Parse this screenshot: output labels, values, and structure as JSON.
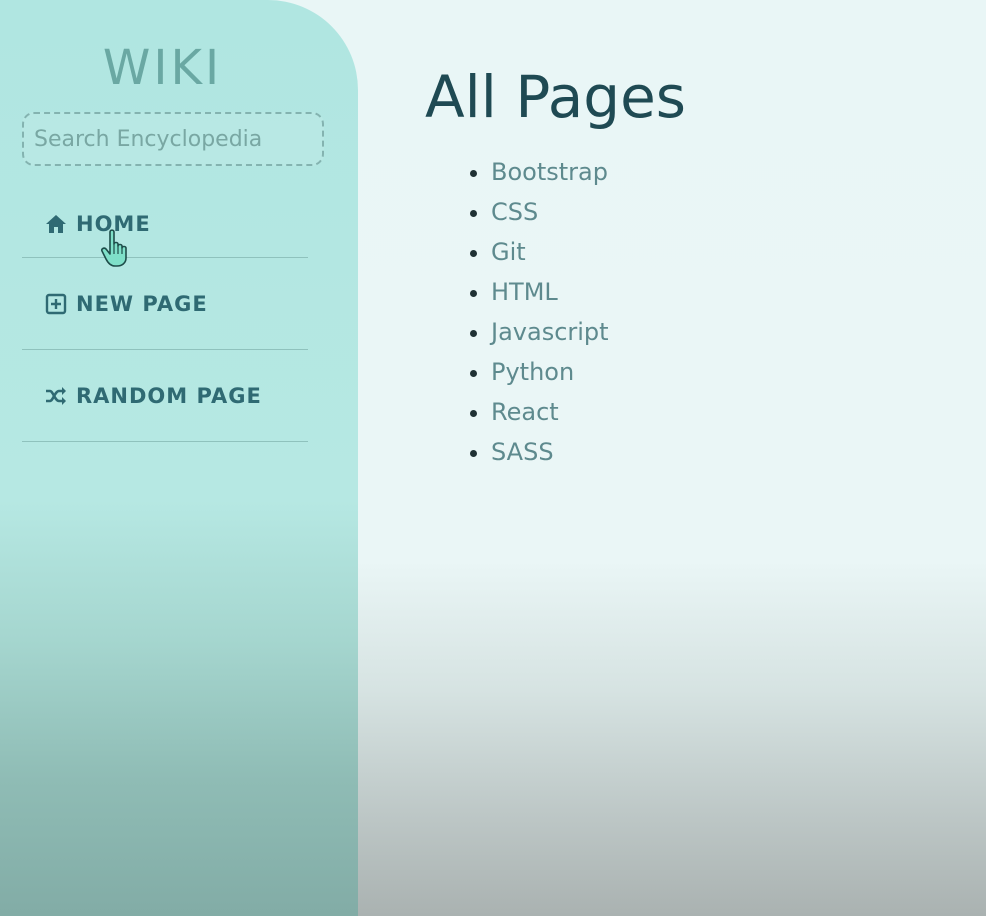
{
  "sidebar": {
    "brand": "WIKI",
    "search_placeholder": "Search Encyclopedia",
    "nav": [
      {
        "label": "HOME",
        "icon": "home-icon"
      },
      {
        "label": "NEW PAGE",
        "icon": "plus-square-icon"
      },
      {
        "label": "RANDOM PAGE",
        "icon": "shuffle-icon"
      }
    ]
  },
  "main": {
    "title": "All Pages",
    "pages": [
      "Bootstrap",
      "CSS",
      "Git",
      "HTML",
      "Javascript",
      "Python",
      "React",
      "SASS"
    ]
  },
  "colors": {
    "sidebar": "#b2e6e1",
    "nav_text": "#2f6a73",
    "title": "#1f4a53",
    "link": "#5e8a8e"
  }
}
